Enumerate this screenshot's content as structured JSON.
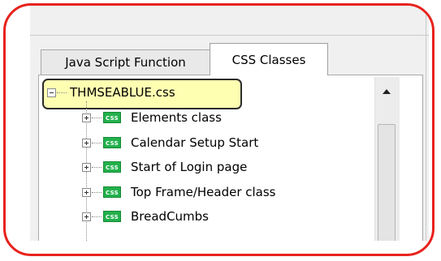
{
  "tabs": [
    {
      "label": "Java Script Function",
      "active": false
    },
    {
      "label": "CSS Classes",
      "active": true
    }
  ],
  "tree": {
    "root": {
      "label": "THMSEABLUE.css",
      "expanded": true
    },
    "icon_text": "CSS",
    "items": [
      {
        "label": "Elements class"
      },
      {
        "label": "Calendar Setup Start"
      },
      {
        "label": "Start of Login page"
      },
      {
        "label": "Top Frame/Header class"
      },
      {
        "label": "BreadCumbs"
      }
    ]
  },
  "colors": {
    "callout_border": "#e8221c",
    "root_highlight": "#ffffb2",
    "css_icon": "#22b14c"
  }
}
